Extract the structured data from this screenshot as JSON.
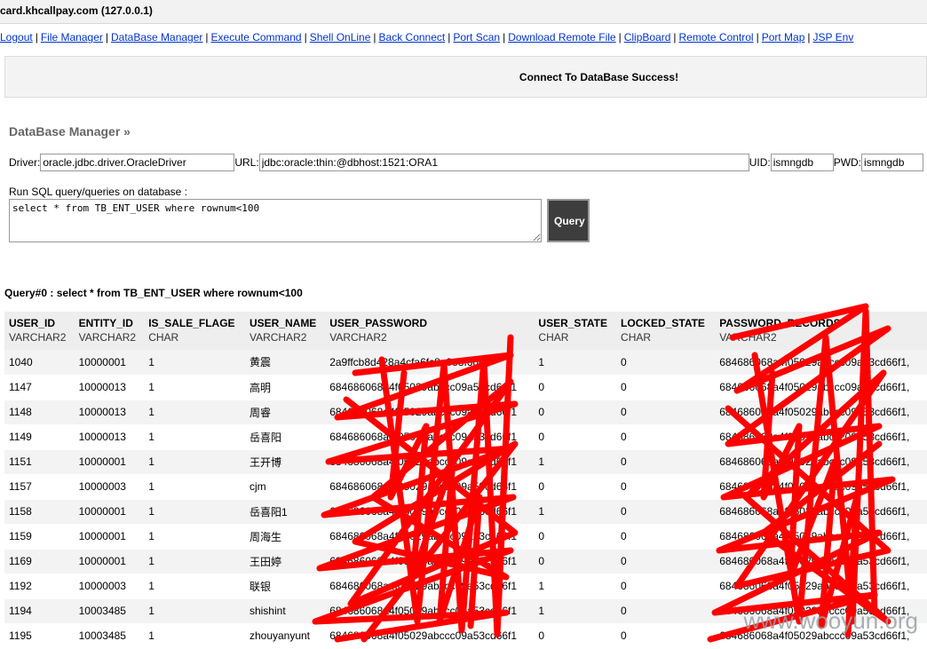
{
  "window": {
    "title": "card.khcallpay.com (127.0.0.1)"
  },
  "nav": [
    {
      "label": "Logout"
    },
    {
      "label": "File Manager"
    },
    {
      "label": "DataBase Manager"
    },
    {
      "label": "Execute Command"
    },
    {
      "label": "Shell OnLine"
    },
    {
      "label": "Back Connect"
    },
    {
      "label": "Port Scan"
    },
    {
      "label": "Download Remote File"
    },
    {
      "label": "ClipBoard"
    },
    {
      "label": "Remote Control"
    },
    {
      "label": "Port Map"
    },
    {
      "label": "JSP Env"
    }
  ],
  "message": "Connect To DataBase Success!",
  "section_title": "DataBase Manager »",
  "connection": {
    "driver_label": "Driver:",
    "driver_value": "oracle.jdbc.driver.OracleDriver",
    "url_label": "URL:",
    "url_value": "jdbc:oracle:thin:@dbhost:1521:ORA1",
    "uid_label": "UID:",
    "uid_value": "ismngdb",
    "pwd_label": "PWD:",
    "pwd_value": "ismngdb"
  },
  "sql": {
    "label": "Run SQL query/queries on database :",
    "value": "select * from TB_ENT_USER where rownum<100",
    "button": "Query"
  },
  "query_title": "Query#0 : select * from TB_ENT_USER where rownum<100",
  "table": {
    "columns": [
      {
        "name": "USER_ID",
        "type": "VARCHAR2"
      },
      {
        "name": "ENTITY_ID",
        "type": "VARCHAR2"
      },
      {
        "name": "IS_SALE_FLAGE",
        "type": "CHAR"
      },
      {
        "name": "USER_NAME",
        "type": "VARCHAR2"
      },
      {
        "name": "USER_PASSWORD",
        "type": "VARCHAR2"
      },
      {
        "name": "USER_STATE",
        "type": "CHAR"
      },
      {
        "name": "LOCKED_STATE",
        "type": "CHAR"
      },
      {
        "name": "PASSWORD_RECORDS",
        "type": "VARCHAR2"
      }
    ],
    "rows": [
      [
        "1040",
        "10000001",
        "1",
        "黄震",
        "2a9ffcb8d428a4cfa6fc8e0e8f6dc8",
        "1",
        "0",
        "684686068a4f05029abccc09a53cd66f1,"
      ],
      [
        "1147",
        "10000013",
        "1",
        "高明",
        "684686068a4f05029abccc09a53cd66f1",
        "0",
        "0",
        "684686068a4f05029abccc09a53cd66f1,"
      ],
      [
        "1148",
        "10000013",
        "1",
        "周睿",
        "684686068a4f05029abccc09a53cd66f1",
        "0",
        "0",
        "684686068a4f05029abccc09a53cd66f1,"
      ],
      [
        "1149",
        "10000013",
        "1",
        "岳喜阳",
        "684686068a4f05029abccc09a53cd66f1",
        "0",
        "0",
        "684686068a4f05029abccc09a53cd66f1,"
      ],
      [
        "1151",
        "10000001",
        "1",
        "王开博",
        "684686068a4f05029abccc09a53cd66f1",
        "1",
        "0",
        "684686068a4f05029abccc09a53cd66f1,"
      ],
      [
        "1157",
        "10000003",
        "1",
        "cjm",
        "684686068a4f05029abccc09a53cd66f1",
        "0",
        "0",
        "684686068a4f05029abccc09a53cd66f1,"
      ],
      [
        "1158",
        "10000001",
        "1",
        "岳喜阳1",
        "684686068a4f05029abccc09a53cd66f1",
        "1",
        "0",
        "684686068a4f05029abccc09a53cd66f1,"
      ],
      [
        "1159",
        "10000001",
        "1",
        "周海生",
        "684686068a4f05029abccc09a53cd66f1",
        "0",
        "0",
        "684686068a4f05029abccc09a53cd66f1,"
      ],
      [
        "1169",
        "10000001",
        "1",
        "王田婷",
        "684686068a4f05029abccc09a53cd66f1",
        "0",
        "0",
        "684686068a4f05029abccc09a53cd66f1,"
      ],
      [
        "1192",
        "10000003",
        "1",
        "联银",
        "684686068a4f05029abccc09a53cd66f1",
        "1",
        "0",
        "684686068a4f05029abccc09a53cd66f1,"
      ],
      [
        "1194",
        "10003485",
        "1",
        "shishint",
        "684686068a4f05029abccc09a53cd66f1",
        "1",
        "0",
        "684686068a4f05029abccc09a53cd66f1,"
      ],
      [
        "1195",
        "10003485",
        "1",
        "zhouyanyunt",
        "684686068a4f05029abccc09a53cd66f1",
        "0",
        "0",
        "684686068a4f05029abccc09a53cd66f1,"
      ]
    ]
  },
  "watermark": "www.wooyun.org",
  "colors": {
    "link": "#0033cc",
    "redaction": "#ff0000",
    "button_bg": "#3d3d3d",
    "row_alt": "#f3f3f3"
  }
}
